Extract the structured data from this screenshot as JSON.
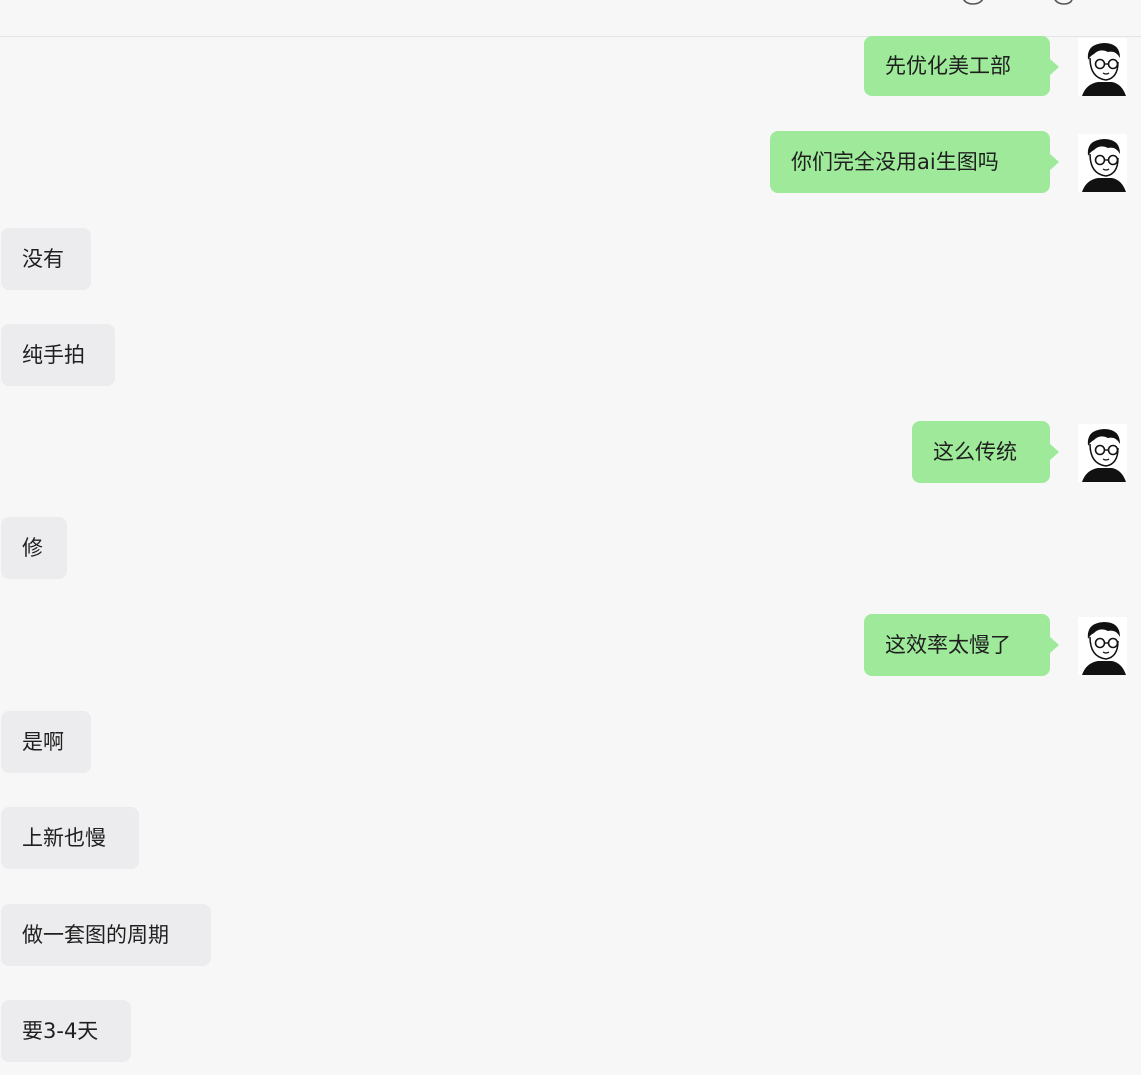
{
  "header": {
    "icons": [
      "chat-bubble-icon",
      "link-icon"
    ]
  },
  "messages": [
    {
      "side": "out",
      "text": "先优化美工部"
    },
    {
      "side": "out",
      "text": "你们完全没用ai生图吗"
    },
    {
      "side": "in",
      "text": "没有"
    },
    {
      "side": "in",
      "text": "纯手拍"
    },
    {
      "side": "out",
      "text": "这么传统"
    },
    {
      "side": "in",
      "text": "修"
    },
    {
      "side": "out",
      "text": "这效率太慢了"
    },
    {
      "side": "in",
      "text": "是啊"
    },
    {
      "side": "in",
      "text": "上新也慢"
    },
    {
      "side": "in",
      "text": "做一套图的周期"
    },
    {
      "side": "in",
      "text": "要3-4天"
    }
  ],
  "colors": {
    "outgoing_bubble": "#9eea9a",
    "incoming_bubble": "#ececee",
    "background": "#f7f7f8"
  },
  "avatar": {
    "icon": "cartoon-man-with-glasses-avatar"
  }
}
